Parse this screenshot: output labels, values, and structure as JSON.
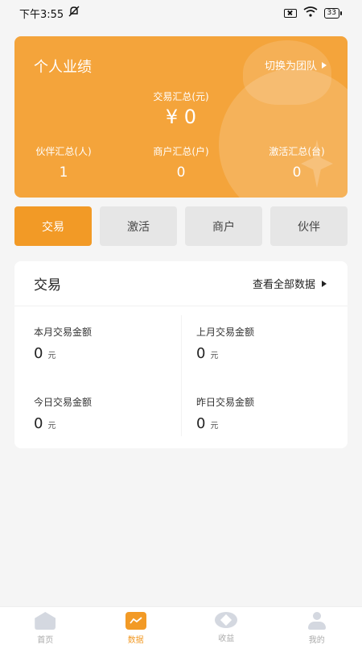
{
  "status_bar": {
    "time": "下午3:55",
    "battery": "33"
  },
  "performance": {
    "title": "个人业绩",
    "switch_label": "切换为团队",
    "total_label": "交易汇总(元)",
    "total_value": "¥ 0",
    "stats": [
      {
        "label": "伙伴汇总(人)",
        "value": "1"
      },
      {
        "label": "商户汇总(户)",
        "value": "0"
      },
      {
        "label": "激活汇总(台)",
        "value": "0"
      }
    ]
  },
  "tabs": [
    {
      "label": "交易",
      "active": true
    },
    {
      "label": "激活",
      "active": false
    },
    {
      "label": "商户",
      "active": false
    },
    {
      "label": "伙伴",
      "active": false
    }
  ],
  "transactions": {
    "title": "交易",
    "view_all": "查看全部数据",
    "cells": [
      {
        "label": "本月交易金额",
        "value": "0",
        "unit": "元"
      },
      {
        "label": "上月交易金额",
        "value": "0",
        "unit": "元"
      },
      {
        "label": "今日交易金额",
        "value": "0",
        "unit": "元"
      },
      {
        "label": "昨日交易金额",
        "value": "0",
        "unit": "元"
      }
    ]
  },
  "bottom_nav": [
    {
      "label": "首页",
      "icon": "home-icon",
      "active": false
    },
    {
      "label": "数据",
      "icon": "chart-icon",
      "active": true
    },
    {
      "label": "收益",
      "icon": "earnings-icon",
      "active": false
    },
    {
      "label": "我的",
      "icon": "profile-icon",
      "active": false
    }
  ],
  "colors": {
    "accent": "#f29a26",
    "card": "#f4a43b",
    "background": "#f5f5f5"
  }
}
